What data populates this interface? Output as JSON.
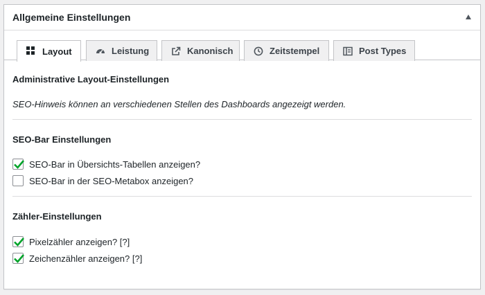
{
  "panel": {
    "title": "Allgemeine Einstellungen",
    "toggle_icon": "triangle-up-icon"
  },
  "tabs": [
    {
      "label": "Layout",
      "icon": "grid-icon",
      "active": true
    },
    {
      "label": "Leistung",
      "icon": "dashboard-gauge-icon",
      "active": false
    },
    {
      "label": "Kanonisch",
      "icon": "external-link-icon",
      "active": false
    },
    {
      "label": "Zeitstempel",
      "icon": "clock-icon",
      "active": false
    },
    {
      "label": "Post Types",
      "icon": "document-icon",
      "active": false
    }
  ],
  "sections": {
    "admin": {
      "heading": "Administrative Layout-Einstellungen",
      "description": "SEO-Hinweis können an verschiedenen Stellen des Dashboards angezeigt werden."
    },
    "seobar": {
      "heading": "SEO-Bar Einstellungen",
      "options": [
        {
          "label": "SEO-Bar in Übersichts-Tabellen anzeigen?",
          "checked": true
        },
        {
          "label": "SEO-Bar in der SEO-Metabox anzeigen?",
          "checked": false
        }
      ]
    },
    "counter": {
      "heading": "Zähler-Einstellungen",
      "options": [
        {
          "label": "Pixelzähler anzeigen? [?]",
          "checked": true
        },
        {
          "label": "Zeichenzähler anzeigen? [?]",
          "checked": true
        }
      ]
    }
  },
  "colors": {
    "check": "#00a32a",
    "border": "#c3c4c7",
    "background": "#f0f0f1"
  }
}
